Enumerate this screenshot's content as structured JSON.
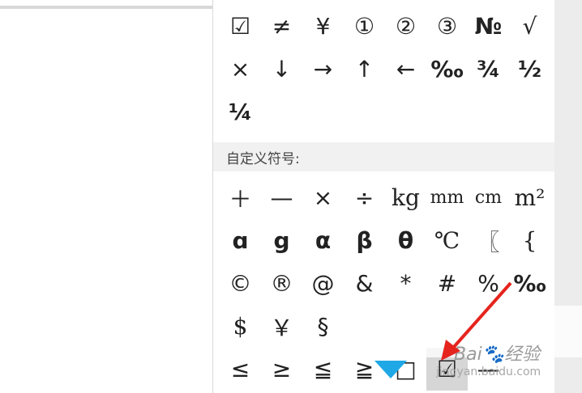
{
  "top_symbols": [
    "☑",
    "≠",
    "¥",
    "①",
    "②",
    "③",
    "№",
    "√",
    "×",
    "↓",
    "→",
    "↑",
    "←",
    "‰",
    "¾",
    "½",
    "¼"
  ],
  "custom_header": "自定义符号:",
  "custom_symbols": [
    "＋",
    "—",
    "×",
    "÷",
    "kg",
    "mm",
    "cm",
    "m²",
    "ɑ",
    "g",
    "α",
    "β",
    "θ",
    "℃",
    "〖",
    "{",
    "©",
    "®",
    "@",
    "&",
    "*",
    "#",
    "%",
    "‰",
    "$",
    "￥",
    "§",
    "",
    "",
    "",
    "",
    "",
    "≤",
    "≥",
    "≦",
    "≧",
    "□",
    "☑",
    "—",
    ""
  ],
  "watermark": {
    "brand": "Bai🐾经验",
    "url": "jingyan.baidu.com"
  },
  "colors": {
    "accent_arrow": "#e5241e",
    "heart": "#1ea8e6",
    "selected_bg": "#d6d6d6"
  }
}
